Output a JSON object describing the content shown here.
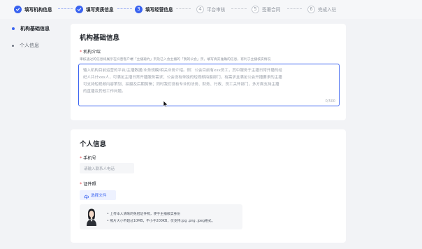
{
  "steps": [
    {
      "label": "填写机构信息",
      "num": "1",
      "state": "done"
    },
    {
      "label": "填写资质信息",
      "num": "2",
      "state": "done"
    },
    {
      "label": "填写经营信息",
      "num": "3",
      "state": "active"
    },
    {
      "label": "平台审核",
      "num": "4",
      "state": "pending"
    },
    {
      "label": "签署合同",
      "num": "5",
      "state": "pending"
    },
    {
      "label": "完成入驻",
      "num": "6",
      "state": "pending"
    }
  ],
  "sidenav": {
    "items": [
      {
        "label": "机构基础信息",
        "active": true
      },
      {
        "label": "个人信息",
        "active": false
      }
    ]
  },
  "org_section": {
    "title": "机构基础信息",
    "intro_label": "机构介绍",
    "required_mark": "*",
    "hint": "审核通过的信息将展示在抖音客户端「主播邀约」页及已入会主播的「我的公会」页，填写真实准确的信息，有利于主播核实情况",
    "placeholder_lines": [
      "输入机构目前运营的平台/主播数据/业务规模/相关业务介绍。例：公会目前有xxx员工，其中服务于主播日常开播的经",
      "纪人共计xxx人，可满足主播日常开播服务需求；公会设有单独的短视频拍摄部门，有需求且满足公会开播要求的主播",
      "可支持短视频内容策划、拍摄及后期剪辑；同时我们设有专业的法务、财务、行政、员工关怀部门，多方面支持主播",
      "的直播及其他工作问题。"
    ],
    "counter": "0/500"
  },
  "personal_section": {
    "title": "个人信息",
    "phone_label": "手机号",
    "phone_placeholder": "请输入联系人电话",
    "id_label": "证件照",
    "upload_label": "选择文件",
    "notice_lines": [
      "• 上传本人清晰的免冠证件照，便于主播核实身份",
      "• 照片大小不超过10MB，不小于200KB，仅支持.jpg .png .jpeg格式。"
    ]
  },
  "colors": {
    "accent": "#3a63f0",
    "background": "#f2f3f6",
    "required": "#e5484d"
  }
}
